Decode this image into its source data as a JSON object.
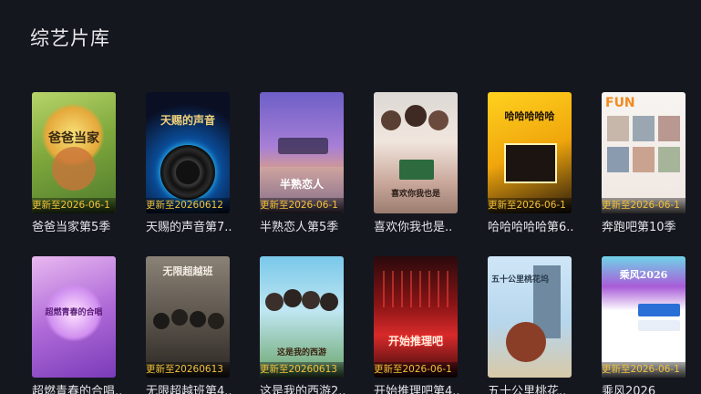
{
  "page": {
    "title": "综艺片库"
  },
  "shows": [
    {
      "title": "爸爸当家第5季",
      "badge": "更新至2026-06-1",
      "poster_text": "爸爸当家",
      "accent": "#9bbf4a"
    },
    {
      "title": "天赐的声音第7..",
      "badge": "更新至20260612",
      "poster_text": "天赐的声音",
      "accent": "#1e88d8"
    },
    {
      "title": "半熟恋人第5季",
      "badge": "更新至2026-06-1",
      "poster_text": "半熟恋人",
      "accent": "#8a6fd1"
    },
    {
      "title": "喜欢你我也是..",
      "badge": "",
      "poster_text": "喜欢你我也是",
      "accent": "#e8c9b8"
    },
    {
      "title": "哈哈哈哈哈第6..",
      "badge": "更新至2026-06-1",
      "poster_text": "哈哈哈哈哈",
      "accent": "#f2c200"
    },
    {
      "title": "奔跑吧第10季",
      "badge": "更新至2026-06-1",
      "poster_text": "FUN",
      "accent": "#f4f1ee"
    },
    {
      "title": "超燃青春的合唱..",
      "badge": "",
      "poster_text": "超燃青春的合唱",
      "accent": "#c58ae6"
    },
    {
      "title": "无限超越班第4..",
      "badge": "更新至20260613",
      "poster_text": "无限超越班",
      "accent": "#6a6258"
    },
    {
      "title": "这是我的西游2..",
      "badge": "更新至20260613",
      "poster_text": "这是我的西游",
      "accent": "#4fb0d8"
    },
    {
      "title": "开始推理吧第4..",
      "badge": "更新至2026-06-1",
      "poster_text": "开始推理吧",
      "accent": "#d82a2a"
    },
    {
      "title": "五十公里桃花..",
      "badge": "",
      "poster_text": "五十公里桃花坞",
      "accent": "#8fc1e6"
    },
    {
      "title": "乘风2026",
      "badge": "更新至2026-06-1",
      "poster_text": "乘风2026",
      "accent": "#d64aa0"
    }
  ]
}
